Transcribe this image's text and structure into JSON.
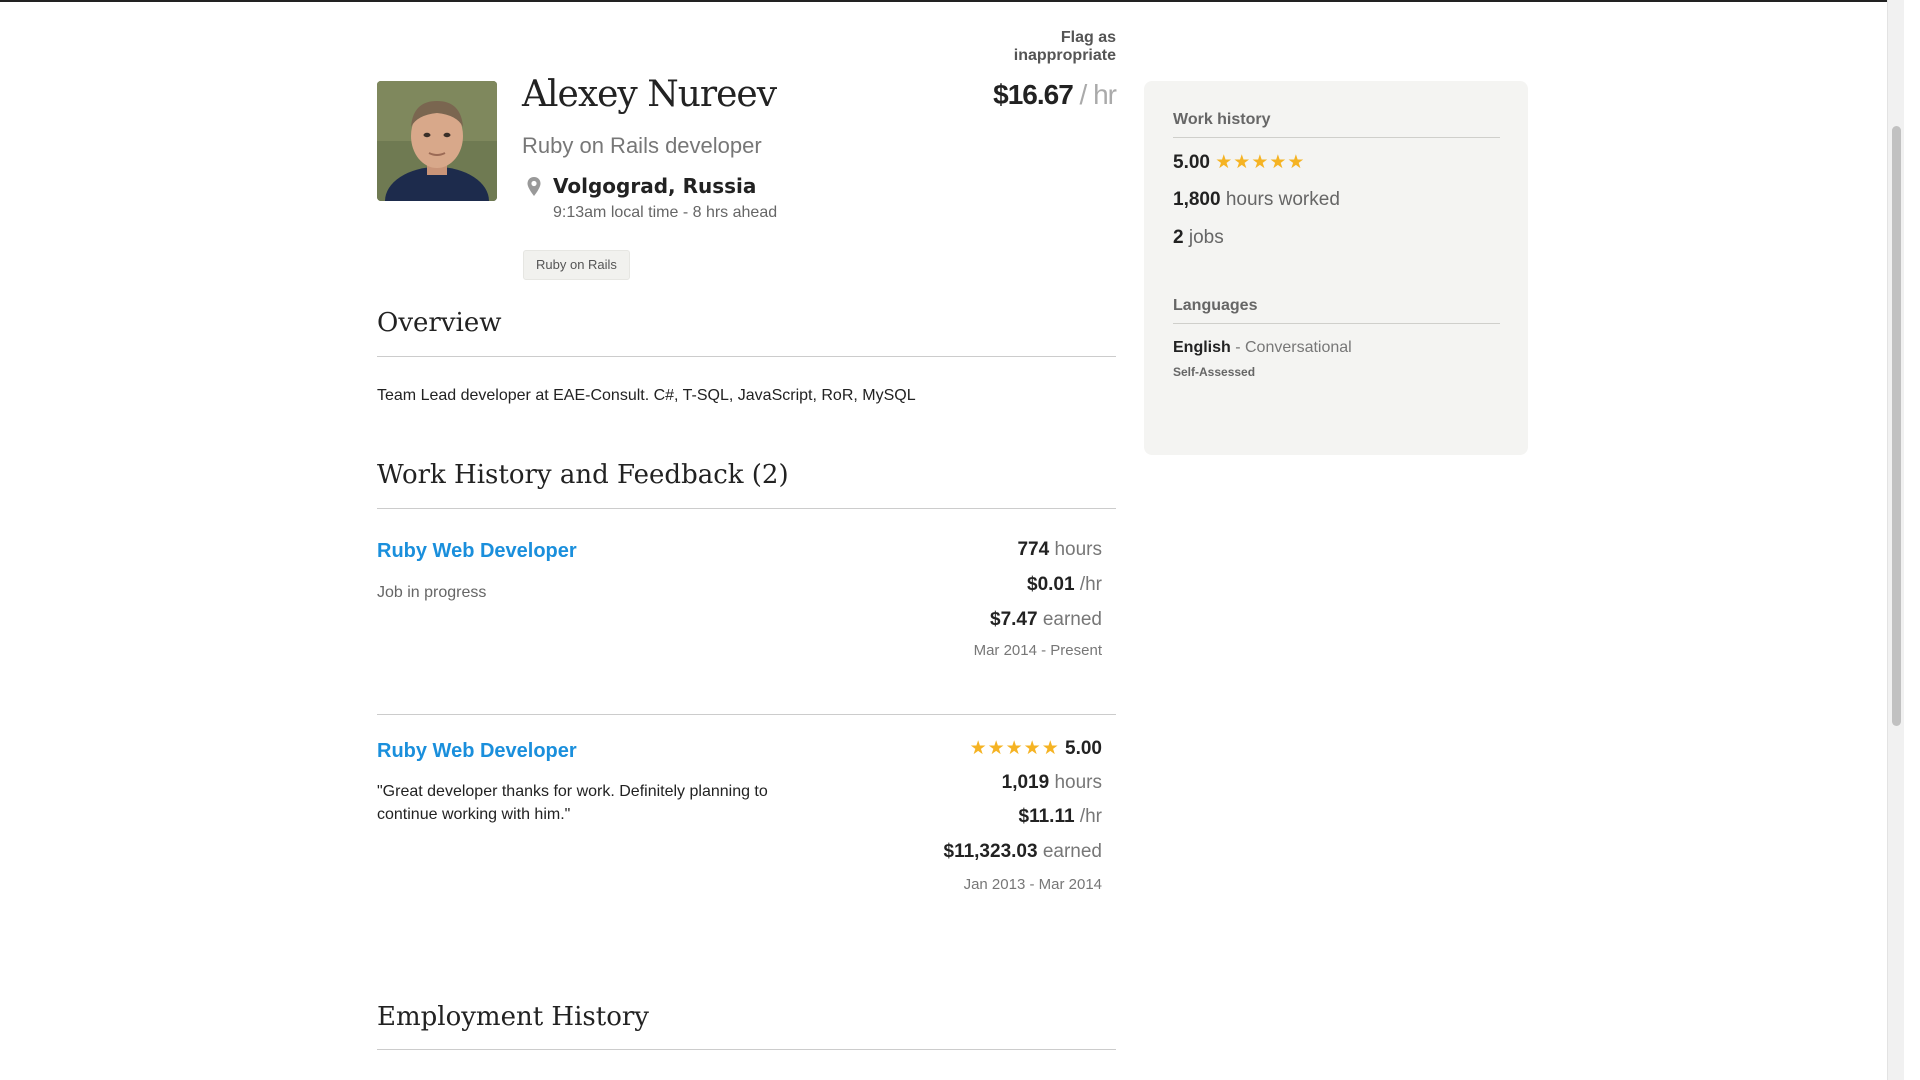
{
  "header": {
    "flag_link": "Flag as inappropriate"
  },
  "profile": {
    "name": "Alexey Nureev",
    "title": "Ruby on Rails developer",
    "location": "Volgograd, Russia",
    "local_time": "9:13am local time - 8 hrs ahead",
    "rate_amount": "$16.67",
    "rate_unit": " / hr",
    "skills": [
      "Ruby on Rails"
    ]
  },
  "overview": {
    "heading": "Overview",
    "text": "Team Lead developer at EAE-Consult. C#, T-SQL, JavaScript, RoR, MySQL"
  },
  "work_history": {
    "heading": "Work History and Feedback (2)",
    "jobs": [
      {
        "title": "Ruby Web Developer",
        "status": "Job in progress",
        "hours": "774",
        "hours_unit": " hours",
        "rate": "$0.01",
        "rate_unit": " /hr",
        "earned": "$7.47",
        "earned_unit": " earned",
        "dates": "Mar 2014 - Present"
      },
      {
        "title": "Ruby Web Developer",
        "feedback": "\"Great developer thanks for work. Definitely planning to continue working with him.\"",
        "rating": "5.00",
        "rating_stars": 5,
        "hours": "1,019",
        "hours_unit": " hours",
        "rate": "$11.11",
        "rate_unit": " /hr",
        "earned": "$11,323.03",
        "earned_unit": " earned",
        "dates": "Jan 2013 - Mar 2014"
      }
    ]
  },
  "employment": {
    "heading": "Employment History"
  },
  "sidebar": {
    "work_history_heading": "Work history",
    "rating": "5.00",
    "rating_stars": 5,
    "hours_worked_value": "1,800",
    "hours_worked_label": " hours worked",
    "jobs_value": "2",
    "jobs_label": " jobs",
    "languages_heading": "Languages",
    "language_name": "English",
    "language_level": " - Conversational",
    "language_note": "Self-Assessed"
  },
  "colors": {
    "link": "#1a8fdc",
    "star": "#f5b323",
    "sidebar_bg": "#f4f4f2"
  },
  "icons": {
    "location": "map-pin-icon",
    "star": "star-icon"
  }
}
